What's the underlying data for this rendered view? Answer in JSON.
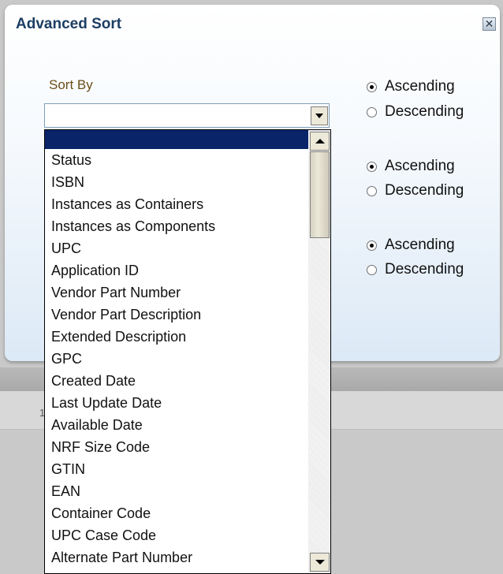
{
  "background": {
    "row_text": "1"
  },
  "dialog": {
    "title": "Advanced Sort",
    "close_icon": "close-icon"
  },
  "sort_by": {
    "label": "Sort By",
    "selected_value": ""
  },
  "sort_orders": [
    {
      "ascending": "Ascending",
      "descending": "Descending",
      "selected": "ascending"
    },
    {
      "ascending": "Ascending",
      "descending": "Descending",
      "selected": "ascending"
    },
    {
      "ascending": "Ascending",
      "descending": "Descending",
      "selected": "ascending"
    }
  ],
  "dropdown": {
    "options": [
      "",
      "Status",
      "ISBN",
      "Instances as Containers",
      "Instances as Components",
      "UPC",
      "Application ID",
      "Vendor Part Number",
      "Vendor Part Description",
      "Extended Description",
      "GPC",
      "Created Date",
      "Last Update Date",
      "Available Date",
      "NRF Size Code",
      "GTIN",
      "EAN",
      "Container Code",
      "UPC Case Code",
      "Alternate Part Number"
    ],
    "highlighted_index": 0
  },
  "colors": {
    "title": "#1c3e63",
    "label": "#6b4f1a",
    "selection": "#0a246a"
  }
}
